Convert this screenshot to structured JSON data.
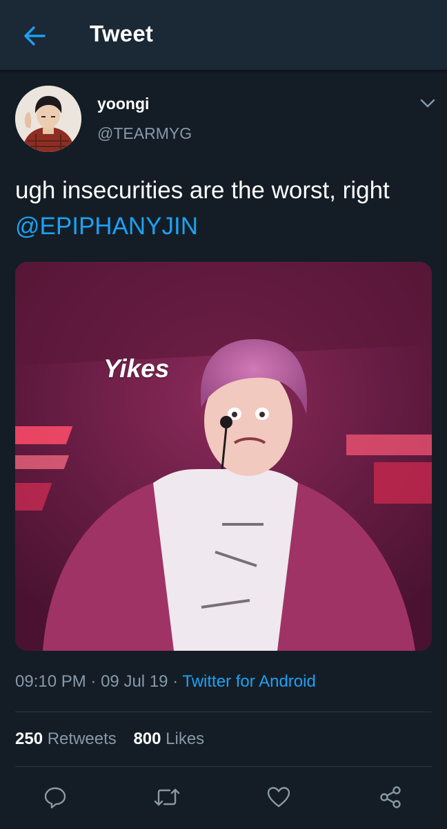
{
  "header": {
    "title": "Tweet",
    "back_icon": "arrow-left-icon"
  },
  "tweet": {
    "author": {
      "display_name": "yoongi",
      "username": "@TEARMYG"
    },
    "text_before": "ugh insecurities are the worst, right ",
    "mention": "@EPIPHANYJIN",
    "media_caption": "Yikes",
    "time": "09:10 PM",
    "separator": "·",
    "date": "09 Jul 19",
    "source": "Twitter for Android",
    "stats": {
      "retweets_count": "250",
      "retweets_label": "Retweets",
      "likes_count": "800",
      "likes_label": "Likes"
    }
  },
  "actions": [
    "reply-icon",
    "retweet-icon",
    "like-icon",
    "share-icon"
  ],
  "colors": {
    "background": "#141d26",
    "header": "#1b2836",
    "accent": "#1da1f2",
    "secondary_text": "#8899a6",
    "divider": "#2c3a48"
  }
}
